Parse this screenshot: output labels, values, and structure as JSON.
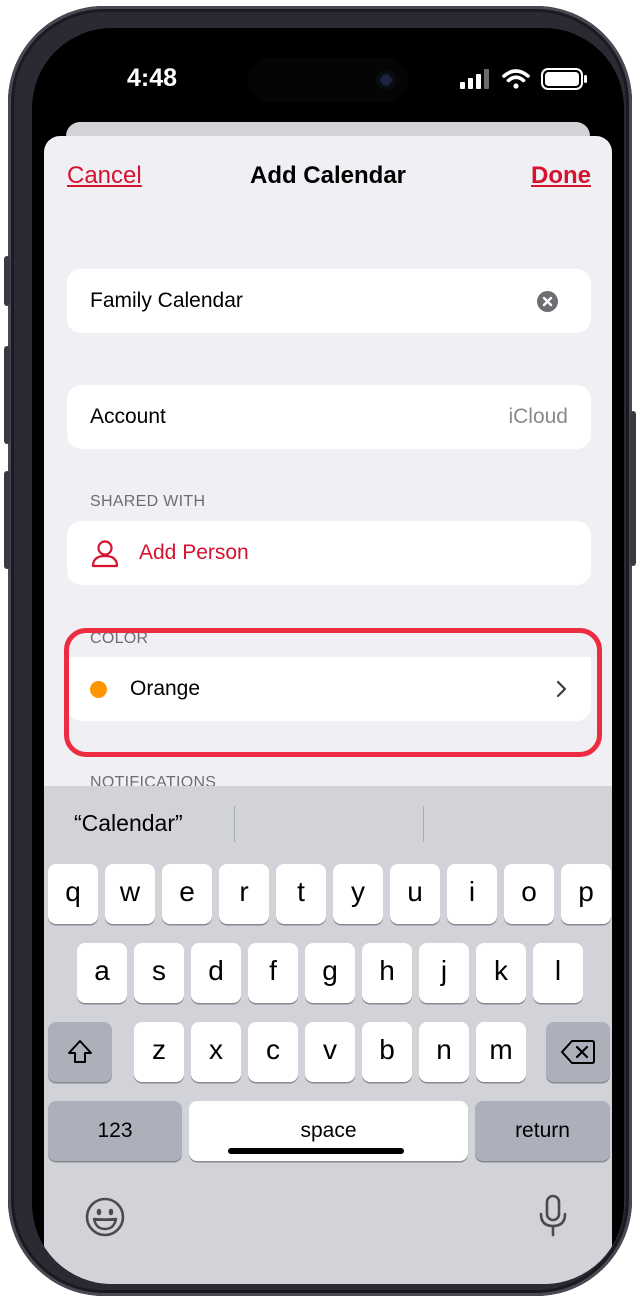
{
  "status_bar": {
    "time": "4:48"
  },
  "nav": {
    "cancel": "Cancel",
    "title": "Add Calendar",
    "done": "Done"
  },
  "name_field": {
    "value": "Family Calendar"
  },
  "account": {
    "label": "Account",
    "value": "iCloud"
  },
  "shared_with": {
    "header": "SHARED WITH",
    "add_person": "Add Person"
  },
  "color": {
    "header": "COLOR",
    "value": "Orange",
    "swatch": "#ff9500"
  },
  "notifications": {
    "header": "NOTIFICATIONS"
  },
  "keyboard": {
    "prediction": "“Calendar”",
    "row1": [
      "q",
      "w",
      "e",
      "r",
      "t",
      "y",
      "u",
      "i",
      "o",
      "p"
    ],
    "row2": [
      "a",
      "s",
      "d",
      "f",
      "g",
      "h",
      "j",
      "k",
      "l"
    ],
    "row3": [
      "z",
      "x",
      "c",
      "v",
      "b",
      "n",
      "m"
    ],
    "numbers": "123",
    "space": "space",
    "return": "return"
  },
  "colors": {
    "accent": "#d7122f",
    "highlight": "#ed2b41"
  }
}
